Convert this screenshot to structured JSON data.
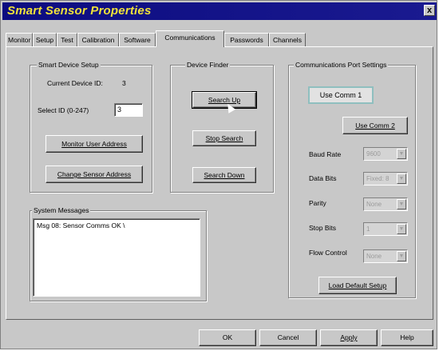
{
  "window": {
    "title": "Smart Sensor Properties",
    "close_glyph": "x"
  },
  "tabs": [
    {
      "label": "Monitor"
    },
    {
      "label": "Setup"
    },
    {
      "label": "Test"
    },
    {
      "label": "Calibration"
    },
    {
      "label": "Software"
    },
    {
      "label": "Communications"
    },
    {
      "label": "Passwords"
    },
    {
      "label": "Channels"
    }
  ],
  "active_tab": "Communications",
  "smart_device_setup": {
    "title": "Smart Device Setup",
    "current_id_label": "Current Device ID:",
    "current_id_value": "3",
    "select_id_label": "Select ID (0-247)",
    "select_id_value": "3",
    "monitor_user_address_label": "Monitor User Address",
    "change_sensor_address_label": "Change Sensor Address"
  },
  "device_finder": {
    "title": "Device Finder",
    "search_up_label": "Search Up",
    "stop_search_label": "Stop Search",
    "search_down_label": "Search Down"
  },
  "comm_port": {
    "title": "Communications Port Settings",
    "status": "Use Comm 1",
    "use_comm2_label": "Use Comm 2",
    "baud_rate_label": "Baud Rate",
    "baud_rate_value": "9600",
    "data_bits_label": "Data Bits",
    "data_bits_value": "Fixed: 8",
    "parity_label": "Parity",
    "parity_value": "None",
    "stop_bits_label": "Stop Bits",
    "stop_bits_value": "1",
    "flow_control_label": "Flow Control",
    "flow_control_value": "None",
    "load_default_label": "Load Default Setup"
  },
  "system_messages": {
    "title": "System Messages",
    "lines": [
      "Msg 08: Sensor Comms OK  \\"
    ]
  },
  "footer": {
    "ok_label": "OK",
    "cancel_label": "Cancel",
    "apply_label": "Apply",
    "help_label": "Help"
  }
}
